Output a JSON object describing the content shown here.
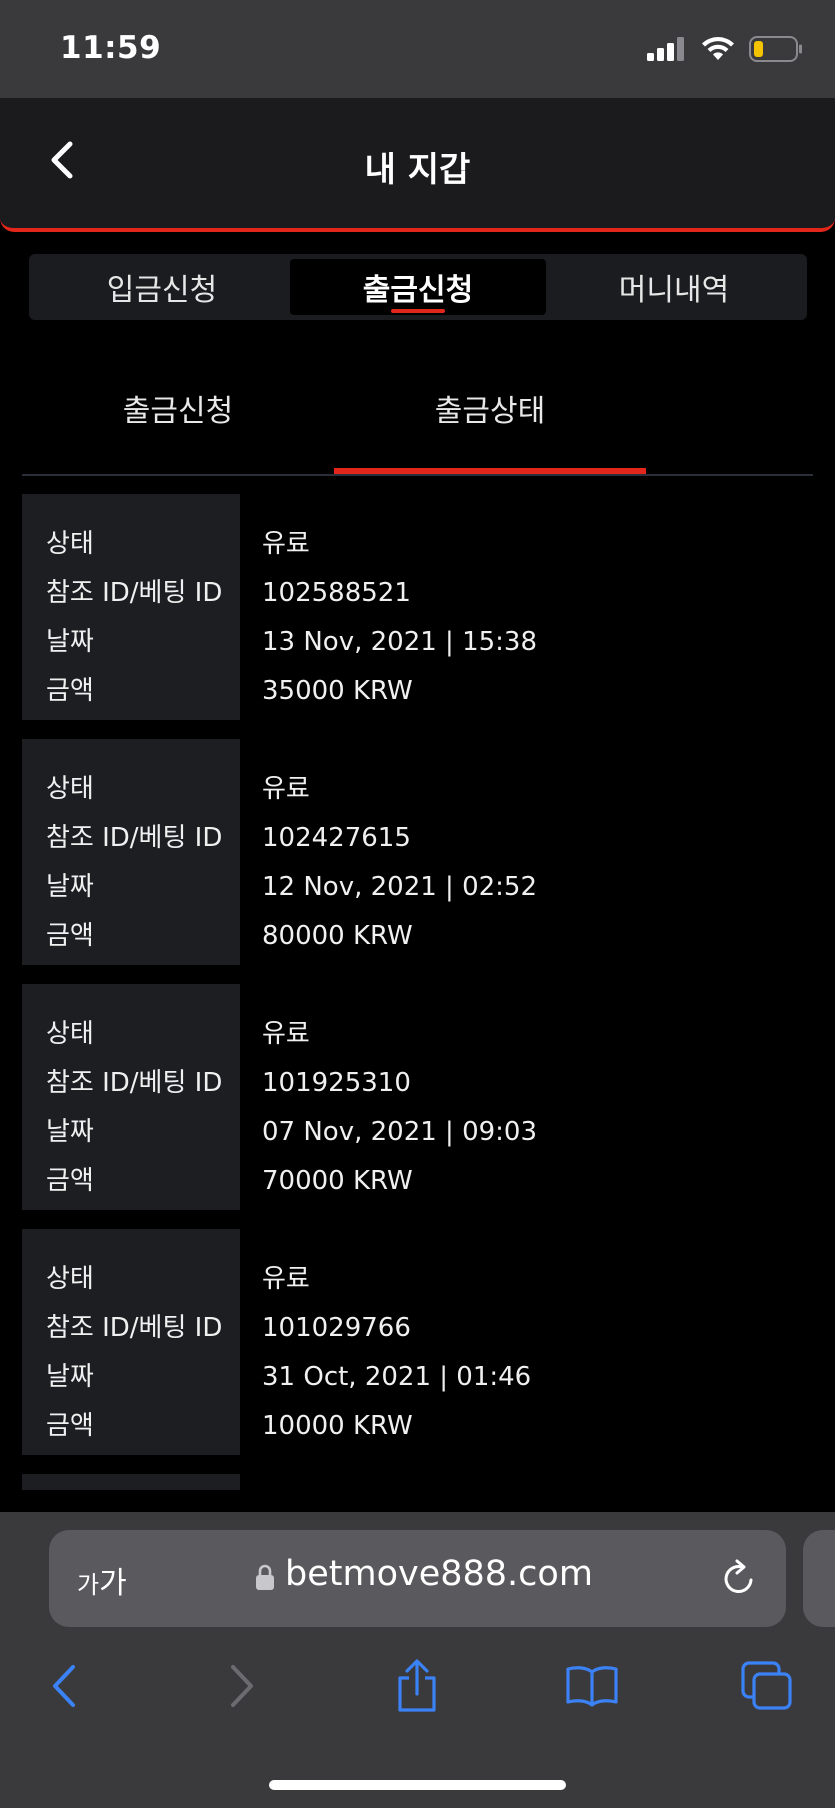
{
  "status": {
    "time": "11:59"
  },
  "header": {
    "title": "내 지갑"
  },
  "tabs": [
    {
      "label": "입금신청",
      "active": false
    },
    {
      "label": "출금신청",
      "active": true
    },
    {
      "label": "머니내역",
      "active": false
    }
  ],
  "subtabs": [
    {
      "label": "출금신청",
      "active": false
    },
    {
      "label": "출금상태",
      "active": true
    }
  ],
  "records": [
    {
      "labels": [
        "상태",
        "참조 ID/베팅 ID",
        "날짜",
        "금액"
      ],
      "values": [
        "유료",
        "102588521",
        "13 Nov, 2021 | 15:38",
        "35000 KRW"
      ]
    },
    {
      "labels": [
        "상태",
        "참조 ID/베팅 ID",
        "날짜",
        "금액"
      ],
      "values": [
        "유료",
        "102427615",
        "12 Nov, 2021 | 02:52",
        "80000 KRW"
      ]
    },
    {
      "labels": [
        "상태",
        "참조 ID/베팅 ID",
        "날짜",
        "금액"
      ],
      "values": [
        "유료",
        "101925310",
        "07 Nov, 2021 | 09:03",
        "70000 KRW"
      ]
    },
    {
      "labels": [
        "상태",
        "참조 ID/베팅 ID",
        "날짜",
        "금액"
      ],
      "values": [
        "유료",
        "101029766",
        "31 Oct, 2021 | 01:46",
        "10000 KRW"
      ]
    }
  ],
  "browser": {
    "text_size_small": "가",
    "text_size_large": "가",
    "url": "betmove888.com"
  },
  "colors": {
    "accent": "#e1261c",
    "ios_blue": "#3b82f6"
  },
  "icons": {
    "back": "chevron-left-icon",
    "lock": "lock-icon",
    "reload": "reload-icon",
    "share": "share-icon",
    "bookmarks": "book-icon",
    "tabs": "tabs-icon"
  }
}
